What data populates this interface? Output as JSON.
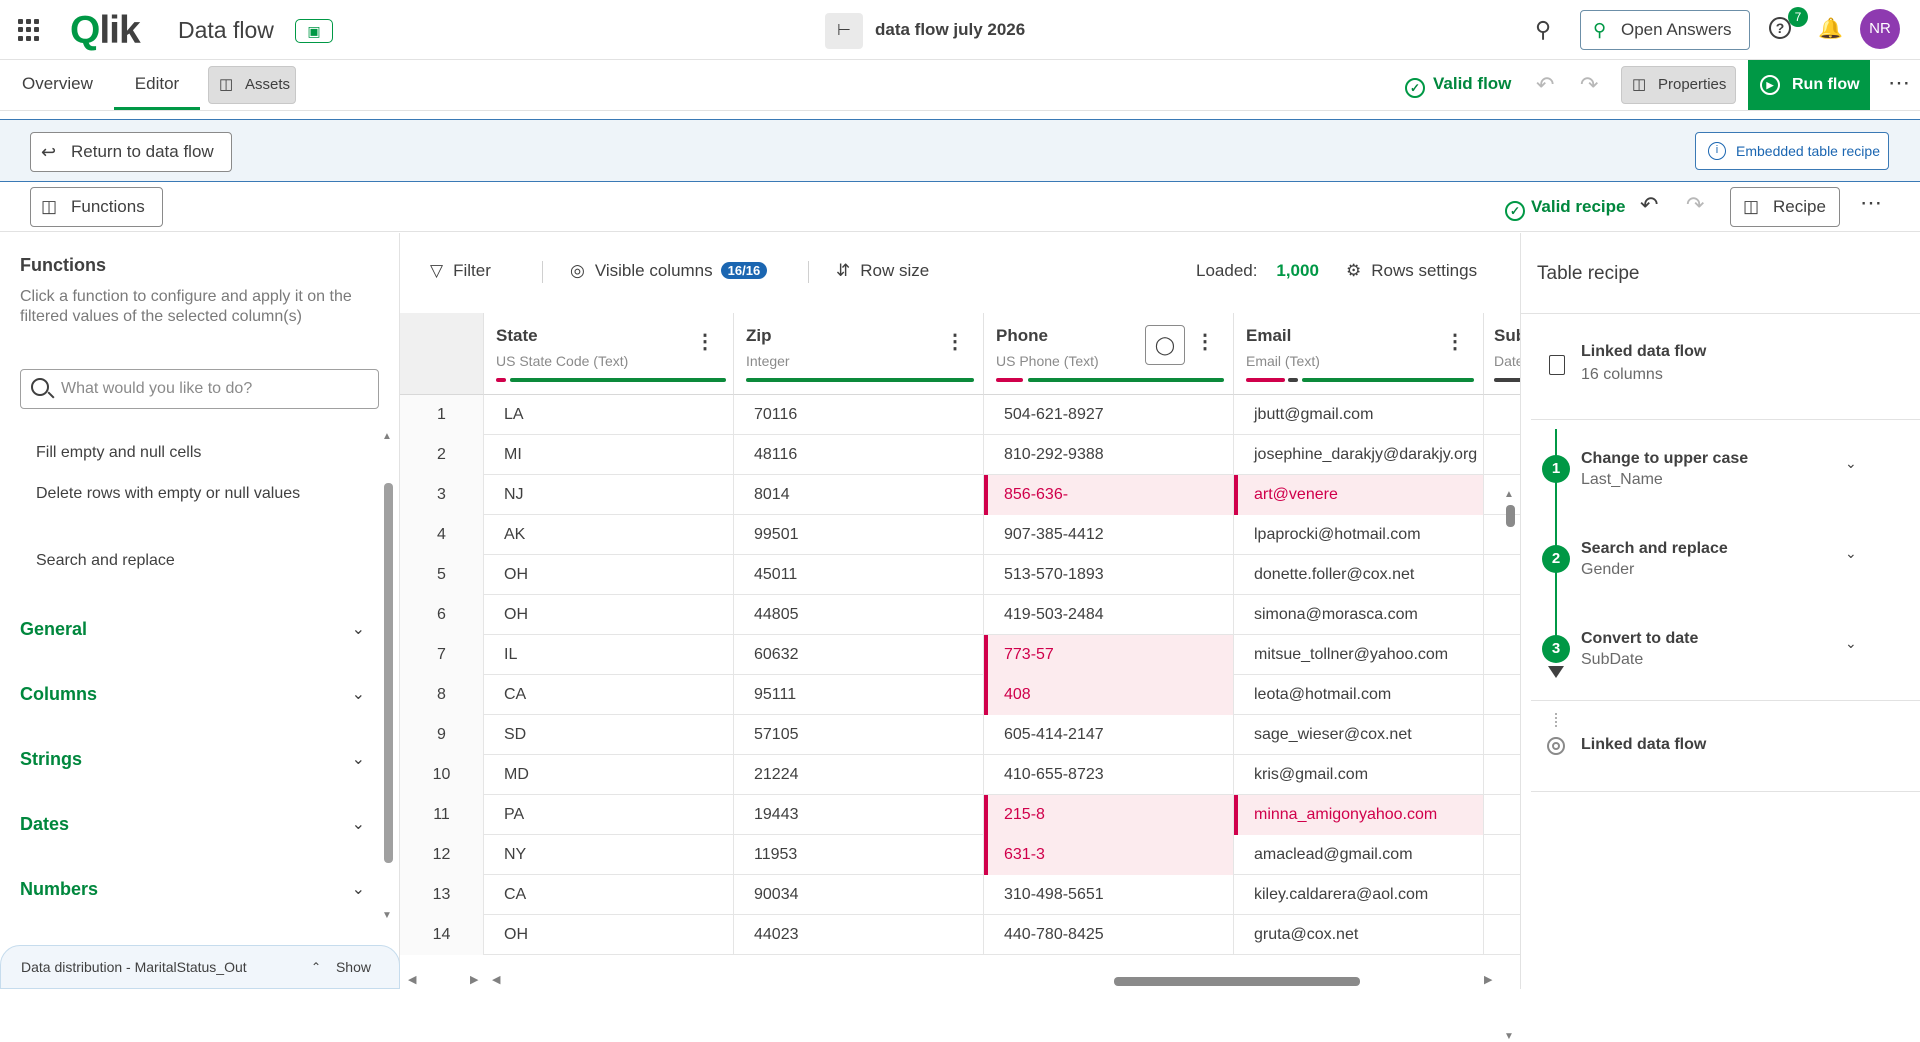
{
  "topbar": {
    "logo_q": "Q",
    "logo_rest": "lik",
    "app_title": "Data flow",
    "book_icon": "book-icon",
    "flow_name": "data flow july 2026",
    "open_answers": "Open Answers",
    "help_badge": "7",
    "avatar": "NR"
  },
  "navbar": {
    "tabs": [
      "Overview",
      "Editor"
    ],
    "active_tab": "Editor",
    "assets": "Assets",
    "valid_flow": "Valid flow",
    "properties": "Properties",
    "run_flow": "Run flow"
  },
  "embed_bar": {
    "return": "Return to data flow",
    "embedded": "Embedded table recipe"
  },
  "recipe_bar": {
    "functions": "Functions",
    "valid_recipe": "Valid recipe",
    "recipe": "Recipe"
  },
  "functions_panel": {
    "title": "Functions",
    "description": "Click a function to configure and apply it on the filtered values of the selected column(s)",
    "search_placeholder": "What would you like to do?",
    "items": [
      "Fill empty and null cells",
      "Delete rows with empty or null values",
      "Search and replace"
    ],
    "categories": [
      "General",
      "Columns",
      "Strings",
      "Dates",
      "Numbers"
    ],
    "data_distribution": "Data distribution - MaritalStatus_Out",
    "show": "Show"
  },
  "toolbar": {
    "filter": "Filter",
    "visible_columns": "Visible columns",
    "visible_count": "16/16",
    "row_size": "Row size",
    "loaded_label": "Loaded:",
    "loaded_value": "1,000",
    "rows_settings": "Rows settings"
  },
  "table": {
    "columns": [
      {
        "name": "State",
        "type": "US State Code (Text)"
      },
      {
        "name": "Zip",
        "type": "Integer"
      },
      {
        "name": "Phone",
        "type": "US Phone (Text)"
      },
      {
        "name": "Email",
        "type": "Email (Text)"
      },
      {
        "name": "Sub",
        "type": "Date"
      }
    ],
    "rows": [
      [
        "1",
        "LA",
        "70116",
        "504-621-8927",
        "jbutt@gmail.com"
      ],
      [
        "2",
        "MI",
        "48116",
        "810-292-9388",
        "josephine_darakjy@darakjy.org"
      ],
      [
        "3",
        "NJ",
        "8014",
        "856-636-",
        "art@venere"
      ],
      [
        "4",
        "AK",
        "99501",
        "907-385-4412",
        "lpaprocki@hotmail.com"
      ],
      [
        "5",
        "OH",
        "45011",
        "513-570-1893",
        "donette.foller@cox.net"
      ],
      [
        "6",
        "OH",
        "44805",
        "419-503-2484",
        "simona@morasca.com"
      ],
      [
        "7",
        "IL",
        "60632",
        "773-57",
        "mitsue_tollner@yahoo.com"
      ],
      [
        "8",
        "CA",
        "95111",
        "408",
        "leota@hotmail.com"
      ],
      [
        "9",
        "SD",
        "57105",
        "605-414-2147",
        "sage_wieser@cox.net"
      ],
      [
        "10",
        "MD",
        "21224",
        "410-655-8723",
        "kris@gmail.com"
      ],
      [
        "11",
        "PA",
        "19443",
        "215-8",
        "minna_amigonyahoo.com"
      ],
      [
        "12",
        "NY",
        "11953",
        "631-3",
        "amaclead@gmail.com"
      ],
      [
        "13",
        "CA",
        "90034",
        "310-498-5651",
        "kiley.caldarera@aol.com"
      ],
      [
        "14",
        "OH",
        "44023",
        "440-780-8425",
        "gruta@cox.net"
      ]
    ]
  },
  "recipe_panel": {
    "title": "Table recipe",
    "source_title": "Linked data flow",
    "source_sub": "16 columns",
    "steps": [
      {
        "num": "1",
        "title": "Change to upper case",
        "sub": "Last_Name"
      },
      {
        "num": "2",
        "title": "Search and replace",
        "sub": "Gender"
      },
      {
        "num": "3",
        "title": "Convert to date",
        "sub": "SubDate"
      }
    ],
    "target": "Linked data flow"
  },
  "colors": {
    "accent": "#009845",
    "blue": "#1b66b1",
    "error": "#d0004b"
  }
}
